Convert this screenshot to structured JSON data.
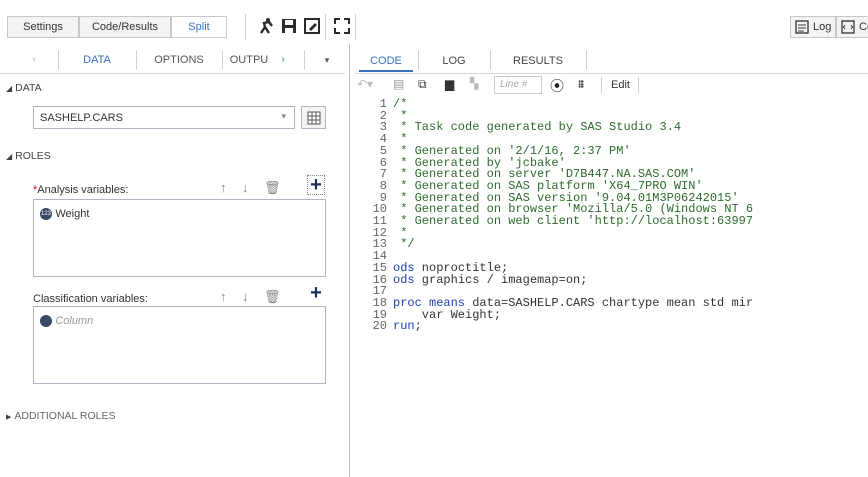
{
  "toolbar": {
    "settings": "Settings",
    "code_results": "Code/Results",
    "split": "Split",
    "log": "Log",
    "code": "Code"
  },
  "left_tabs": [
    "DATA",
    "OPTIONS",
    "OUTPU"
  ],
  "data_section": {
    "header": "DATA",
    "dataset": "SASHELP.CARS"
  },
  "roles_section": {
    "header": "ROLES",
    "required_mark": "*",
    "analysis_label": "Analysis variables:",
    "analysis_item": "Weight",
    "classification_label": "Classification variables:",
    "classification_placeholder": "Column"
  },
  "additional_roles": "ADDITIONAL ROLES",
  "right_tabs": [
    "CODE",
    "LOG",
    "RESULTS"
  ],
  "code_toolbar": {
    "line_placeholder": "Line #",
    "edit": "Edit"
  },
  "code_lines": [
    "/*",
    " *",
    " * Task code generated by SAS Studio 3.4",
    " *",
    " * Generated on '2/1/16, 2:37 PM'",
    " * Generated by 'jcbake'",
    " * Generated on server 'D7B447.NA.SAS.COM'",
    " * Generated on SAS platform 'X64_7PRO WIN'",
    " * Generated on SAS version '9.04.01M3P06242015'",
    " * Generated on browser 'Mozilla/5.0 (Windows NT 6",
    " * Generated on web client 'http://localhost:63997",
    " *",
    " */",
    "",
    "ods noproctitle;",
    "ods graphics / imagemap=on;",
    "",
    "proc means data=SASHELP.CARS chartype mean std mir",
    "    var Weight;",
    "run;"
  ],
  "colors": {
    "accent": "#3a6fbf",
    "keyword": "#1a3fb0",
    "comment": "#2e6b2e"
  }
}
